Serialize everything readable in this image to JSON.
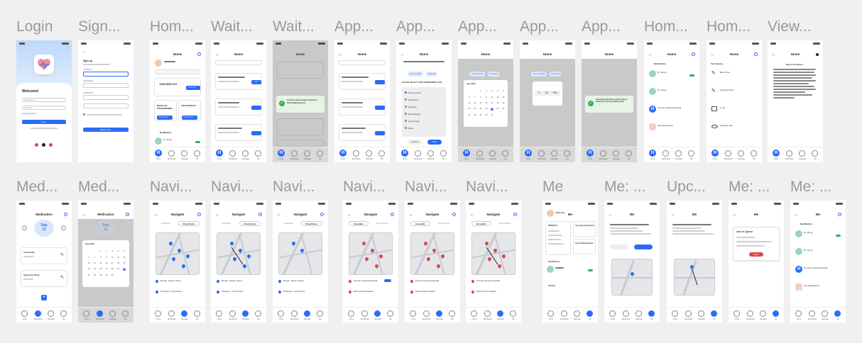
{
  "frames": [
    {
      "title": "Login"
    },
    {
      "title": "Sign..."
    },
    {
      "title": "Hom..."
    },
    {
      "title": "Wait..."
    },
    {
      "title": "Wait..."
    },
    {
      "title": "App..."
    },
    {
      "title": "App..."
    },
    {
      "title": "App..."
    },
    {
      "title": "App..."
    },
    {
      "title": "App..."
    },
    {
      "title": "Hom..."
    },
    {
      "title": "Hom..."
    },
    {
      "title": "View..."
    },
    {
      "title": "Med..."
    },
    {
      "title": "Med..."
    },
    {
      "title": "Navi..."
    },
    {
      "title": "Navi..."
    },
    {
      "title": "Navi..."
    },
    {
      "title": "Navi..."
    },
    {
      "title": "Navi..."
    },
    {
      "title": "Navi..."
    },
    {
      "title": "Me"
    },
    {
      "title": "Me: ..."
    },
    {
      "title": "Upc..."
    },
    {
      "title": "Me: ..."
    },
    {
      "title": "Me: ..."
    }
  ],
  "headers": {
    "home": "Home",
    "medication": "Medication",
    "navigate": "Navigate",
    "me": "Me"
  },
  "login": {
    "welcome": "Welcome!",
    "email_placeholder": "Email Address",
    "password_placeholder": "Password",
    "forgot": "Forgot password?",
    "login_label": "Log in"
  },
  "signup": {
    "title": "Sign up",
    "button": "Register Now"
  },
  "home": {
    "join_waitlist": "JOIN WAITLIST",
    "join_now": "JOIN NOW",
    "book_appt": "BOOK AN APPOINTMENT",
    "your_result": "YOUR RESULT",
    "book_now": "BOOK NOW",
    "view_result": "VIEW RESULT",
    "notification": "Notification",
    "dr_wong": "Dr. Wong"
  },
  "waitlist": {
    "success": "You Have Successfully Joined The Virtual Waiting Room",
    "join": "JOIN"
  },
  "appointment": {
    "question": "PLEASE SELECT YOUR APPOINTMENT TYPE",
    "date": "Jul 10, 2024",
    "time": "9:41 AM",
    "types": [
      "Primary Care",
      "Optometry",
      "Dentistry",
      "Dermatology",
      "Gynecology",
      "Other"
    ],
    "cancel": "Cancel",
    "next": "Next",
    "booked": "Appointment Booked on Jul 23, 9pm at University of Toronto Walk-in Clinic",
    "month": "Jan 2024"
  },
  "notifications": {
    "title": "Notification",
    "items": [
      "Dr. Wong",
      "Dr. Wong",
      "Toronto General Hospital",
      "App Registration"
    ]
  },
  "test_history": {
    "title": "Test History",
    "items": [
      "Blood Test",
      "Urinalysis Test",
      "X-ray",
      "Eyesight Test"
    ]
  },
  "view_result": {
    "title": "Blood Test Report"
  },
  "medication": {
    "month": "Sep",
    "day": "11",
    "cal_month": "Sep 2024",
    "meds": [
      "Amoxicillin",
      "Ibuprofen 50mg"
    ]
  },
  "navigate": {
    "hospitals": "Hospitals",
    "drug_stores": "Drug Stores",
    "store1": "Rexall - Queen Street",
    "store2": "Shoppers - King Street",
    "hosp1": "Toronto General Hospital",
    "hosp2": "Mount Sinai Hospital"
  },
  "me": {
    "name": "John Doe",
    "profile": "PROFILE",
    "upcoming": "Upcoming Appointment",
    "current_wait": "Current Waiting Status",
    "notification": "Notification",
    "setting": "Setting",
    "line_queue": "Line In Queue",
    "leave": "Leave"
  },
  "nav_labels": [
    "Home",
    "Medication",
    "Navigate",
    "Me"
  ],
  "colors": {
    "accent": "#2b6cf6",
    "success": "#31b34a",
    "pin_red": "#d84a4a",
    "bg": "#f0f0f0"
  }
}
